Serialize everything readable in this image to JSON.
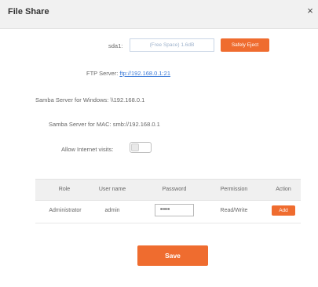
{
  "dialog": {
    "title": "File Share",
    "close_glyph": "×"
  },
  "storage": {
    "label": "sda1:",
    "space_text": "(Free Space) 1.6dB",
    "safely_eject_label": "Safely Eject"
  },
  "ftp": {
    "label": "FTP Server:",
    "url": "ftp://192.168.0.1:21"
  },
  "samba_windows": {
    "label": "Samba Server for Windows:",
    "value": "\\\\192.168.0.1"
  },
  "samba_mac": {
    "label": "Samba Server for MAC:",
    "value": "smb://192.168.0.1"
  },
  "internet": {
    "label": "Allow Internet visits:",
    "enabled": false
  },
  "users_table": {
    "headers": [
      "Role",
      "User name",
      "Password",
      "Permission",
      "Action"
    ],
    "rows": [
      {
        "role": "Administrator",
        "username": "admin",
        "password": "•••••",
        "permission": "Read/Write",
        "action": "Add"
      }
    ]
  },
  "save_label": "Save",
  "colors": {
    "accent": "#ef6c2f",
    "link": "#3b7ad8",
    "header_bg": "#f1f1f1"
  }
}
